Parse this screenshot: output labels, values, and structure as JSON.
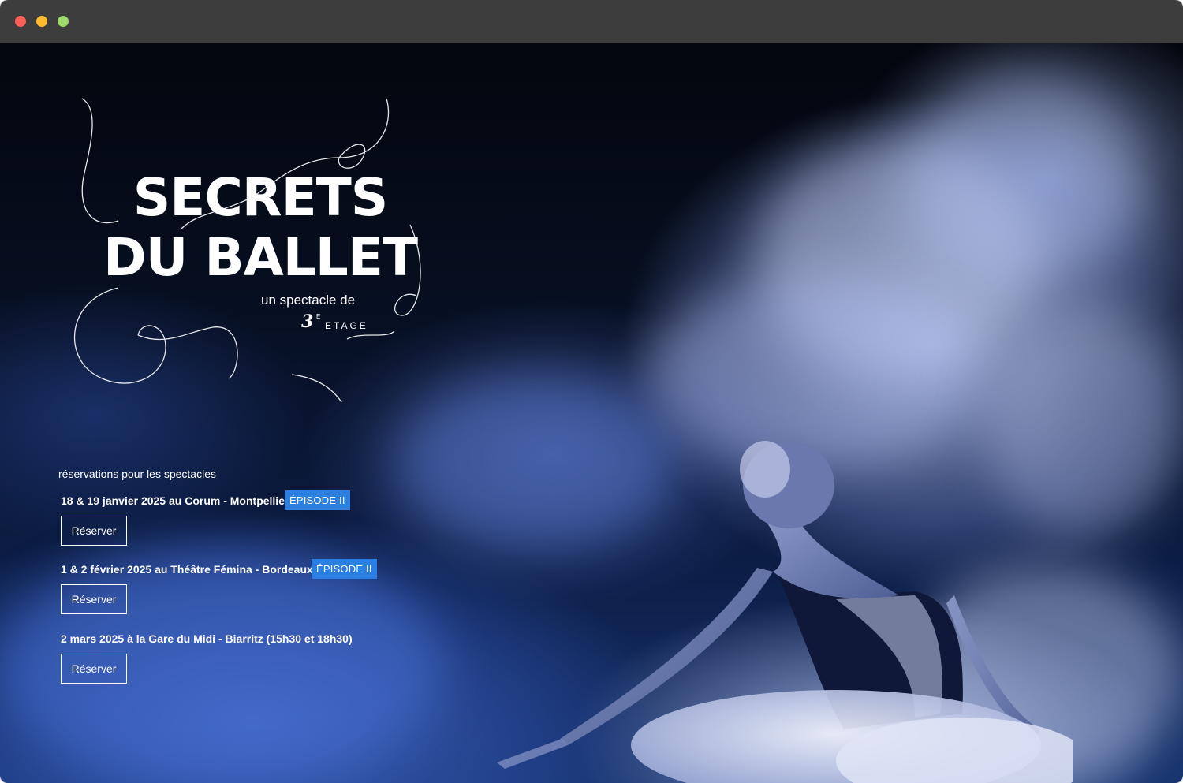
{
  "window": {
    "controls": [
      "close",
      "minimize",
      "maximize"
    ]
  },
  "hero": {
    "title_line1": "SECRETS",
    "title_line2": "DU BALLET",
    "byline": "un spectacle de",
    "logo": {
      "number": "3",
      "superscript": "E",
      "word": "ETAGE"
    }
  },
  "reservations": {
    "intro": "réservations pour les spectacles",
    "events": [
      {
        "text": "18 & 19 janvier 2025 au Corum - Montpellier",
        "badge": "ÉPISODE II",
        "button": "Réserver"
      },
      {
        "text": "1 & 2 février 2025 au Théâtre Fémina - Bordeaux",
        "badge": "ÉPISODE II",
        "button": "Réserver"
      },
      {
        "text": "2 mars 2025 à la Gare du Midi - Biarritz (15h30 et 18h30)",
        "badge": "",
        "button": "Réserver"
      }
    ]
  },
  "colors": {
    "badge": "#2b7fe0",
    "titlebar": "#3d3d3d"
  }
}
